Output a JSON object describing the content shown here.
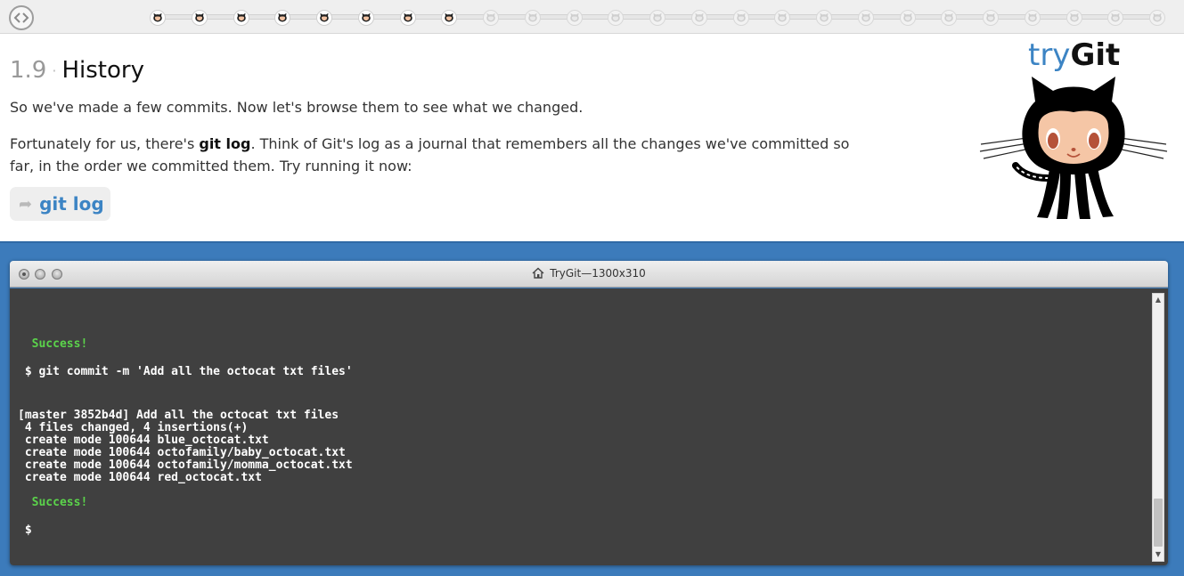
{
  "progress": {
    "total_steps": 25,
    "completed_steps": 8
  },
  "lesson": {
    "number": "1.9",
    "separator": "·",
    "title": "History",
    "intro": "So we've made a few commits. Now let's browse them to see what we changed.",
    "body_before": "Fortunately for us, there's ",
    "body_bold": "git log",
    "body_after": ". Think of Git's log as a journal that remembers all the changes we've committed so far, in the order we committed them. Try running it now:",
    "command_icon": "arrow-icon",
    "command_arrow": "➦",
    "command": "git log"
  },
  "logo": {
    "try": "try",
    "git": "Git"
  },
  "terminal": {
    "title": "TryGit—1300x310",
    "lines": [
      {
        "text": "  Success!",
        "kind": "success"
      },
      {
        "text": " $ git commit -m 'Add all the octocat txt files'",
        "kind": "prompt"
      },
      {
        "text": "[master 3852b4d] Add all the octocat txt files",
        "kind": "output"
      },
      {
        "text": " 4 files changed, 4 insertions(+)",
        "kind": "output"
      },
      {
        "text": " create mode 100644 blue_octocat.txt",
        "kind": "output"
      },
      {
        "text": " create mode 100644 octofamily/baby_octocat.txt",
        "kind": "output"
      },
      {
        "text": " create mode 100644 octofamily/momma_octocat.txt",
        "kind": "output"
      },
      {
        "text": " create mode 100644 red_octocat.txt",
        "kind": "output"
      },
      {
        "text": "  Success!",
        "kind": "success"
      },
      {
        "text": " $",
        "kind": "prompt"
      }
    ]
  },
  "colors": {
    "accent": "#3c84c4",
    "success": "#5bd34b",
    "console_bg": "#404040",
    "frame_blue": "#3c7bbb"
  }
}
